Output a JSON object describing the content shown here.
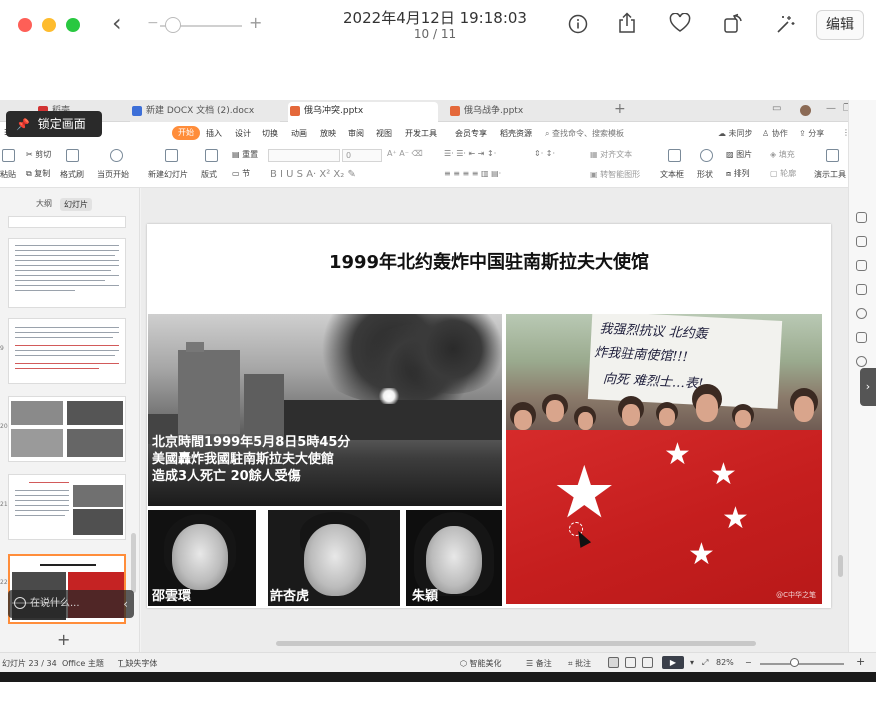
{
  "viewer": {
    "date": "2022年4月12日 19:18:03",
    "count": "10 / 11",
    "edit_label": "编辑"
  },
  "wps_tabs": {
    "tab_a": "稻壳",
    "tab_b": "新建 DOCX 文档 (2).docx",
    "tab_c": "俄乌冲突.pptx",
    "tab_d": "俄乌战争.pptx"
  },
  "lock_overlay": "锁定画面",
  "menu": {
    "start": "开始",
    "items": [
      "插入",
      "设计",
      "切换",
      "动画",
      "放映",
      "审阅",
      "视图",
      "开发工具",
      "会员专享",
      "稻壳资源"
    ],
    "search": "查找命令、搜索模板",
    "sync": "未同步",
    "collab": "协作",
    "share": "分享"
  },
  "ribbon": {
    "paste": "粘贴",
    "cut": "剪切",
    "copy": "复制",
    "format_painter": "格式刷",
    "from_current": "当页开始",
    "new_slide": "新建幻灯片",
    "layout": "版式",
    "section": "节",
    "reset": "重置",
    "font_size": "0",
    "align_text": "对齐文本",
    "smartart": "转智能图形",
    "textbox": "文本框",
    "shape": "形状",
    "picture": "图片",
    "arrange": "排列",
    "fill": "填充",
    "outline": "轮廓",
    "presentation_tools": "演示工具"
  },
  "panel": {
    "tab_outline": "大纲",
    "tab_slides": "幻灯片",
    "nums": [
      "9",
      "20",
      "21",
      "22",
      "23"
    ],
    "overlay_text": "在说什么..."
  },
  "slide": {
    "title": "1999年北约轰炸中国驻南斯拉夫大使馆",
    "caption_line1": "北京時間1999年5月8日5時45分",
    "caption_line2": "美國轟炸我國駐南斯拉夫大使館",
    "caption_line3": "造成3人死亡 20餘人受傷",
    "names": [
      "邵雲環",
      "許杏虎",
      "朱穎"
    ],
    "banner_line1": "我强烈抗议 北约轰",
    "banner_line2": "炸我驻南使馆!!!",
    "banner_line3": "向死 难烈士…表!",
    "watermark": "@C中华之笔"
  },
  "status": {
    "slide_count": "幻灯片 23 / 34",
    "theme": "Office 主题",
    "missing_font": "缺失字体",
    "beautify": "智能美化",
    "notes": "备注",
    "comment": "批注",
    "zoom": "82%"
  },
  "colors": {
    "accent": "#ff8d3a",
    "flag_red": "#cc2323"
  }
}
